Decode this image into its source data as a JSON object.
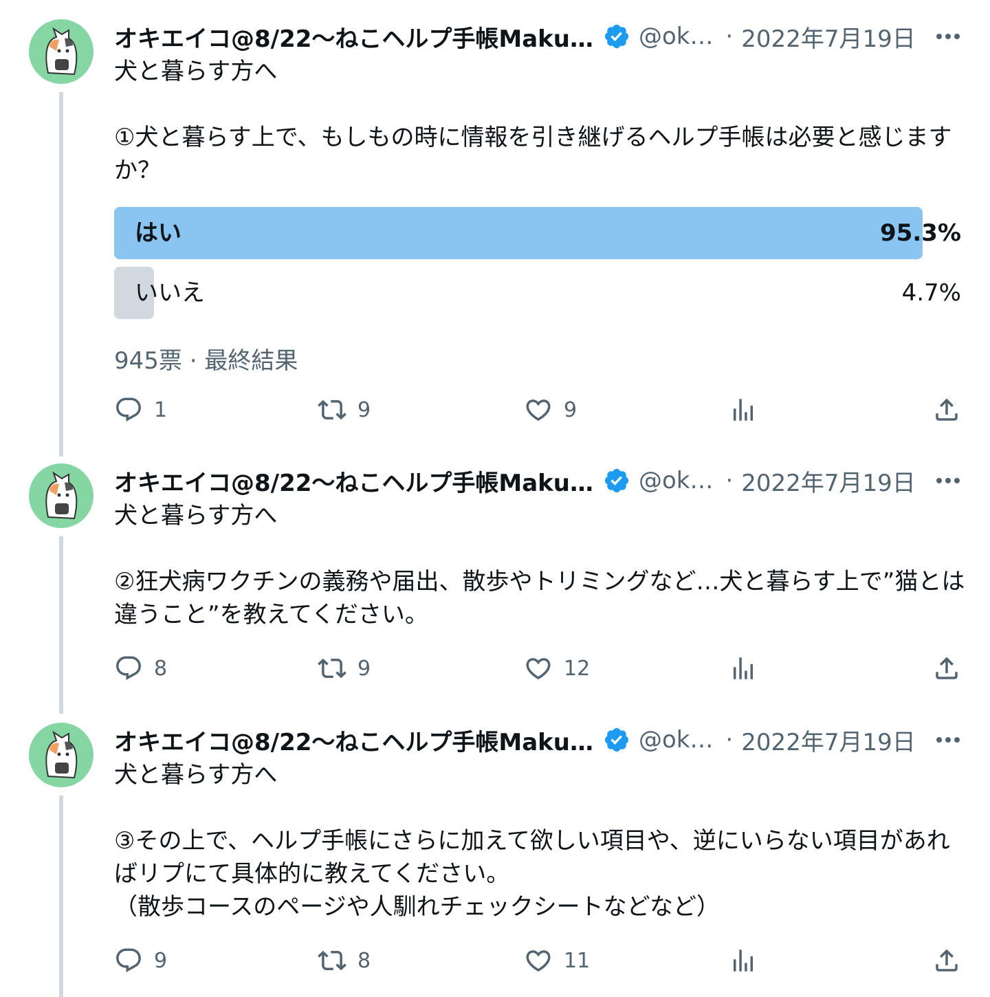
{
  "author": {
    "name": "オキエイコ@8/22〜ねこヘルプ手帳Maku…",
    "handle": "@ok…",
    "date": "2022年7月19日"
  },
  "colors": {
    "verified": "#1d9bf0",
    "poll_winner": "#8ac5f2",
    "poll_other": "#cfd9de",
    "avatar_bg": "#86d6a4"
  },
  "icons": [
    "reply-icon",
    "retweet-icon",
    "like-icon",
    "views-icon",
    "share-icon",
    "more-icon",
    "verified-icon"
  ],
  "tweets": [
    {
      "text": "犬と暮らす方へ\n\n①犬と暮らす上で、もしもの時に情報を引き継げるヘルプ手帳は必要と感じますか？",
      "poll": {
        "options": [
          {
            "label": "はい",
            "percent": "95.3%",
            "fraction": 0.953
          },
          {
            "label": "いいえ",
            "percent": "4.7%",
            "fraction": 0.047
          }
        ],
        "meta": "945票 · 最終結果"
      },
      "replies": "1",
      "retweets": "9",
      "likes": "9"
    },
    {
      "text": "犬と暮らす方へ\n\n②狂犬病ワクチンの義務や届出、散歩やトリミングなど…犬と暮らす上で”猫とは違うこと”を教えてください。",
      "replies": "8",
      "retweets": "9",
      "likes": "12"
    },
    {
      "text": "犬と暮らす方へ\n\n③その上で、ヘルプ手帳にさらに加えて欲しい項目や、逆にいらない項目があればリプにて具体的に教えてください。\n（散歩コースのページや人馴れチェックシートなどなど）",
      "replies": "9",
      "retweets": "8",
      "likes": "11"
    }
  ],
  "separator": "·"
}
